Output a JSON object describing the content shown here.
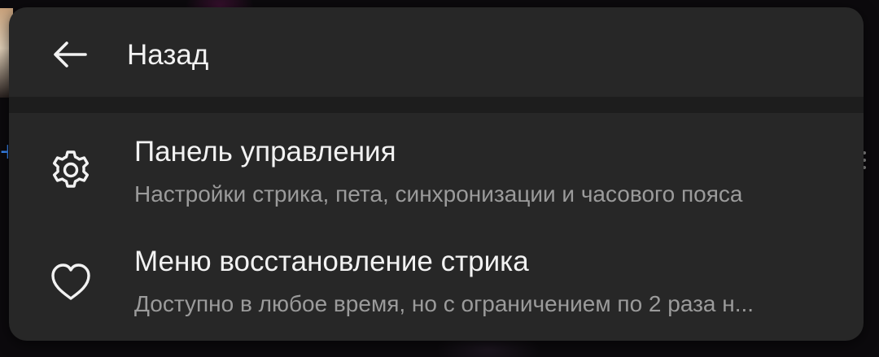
{
  "menu": {
    "header": {
      "back_icon": "arrow-left-icon",
      "title": "Назад"
    },
    "items": [
      {
        "icon": "gear-icon",
        "title": "Панель управления",
        "subtitle": "Настройки стрика, пета, синхронизации и часового пояса"
      },
      {
        "icon": "heart-icon",
        "title": "Меню восстановление стрика",
        "subtitle": "Доступно в любое время, но с ограничением по 2 раза н..."
      }
    ]
  },
  "colors": {
    "menu_background": "#272727",
    "separator": "#1d1d1d",
    "primary_text": "#f2f2f2",
    "secondary_text": "#9b9b9b",
    "page_background": "#0c0a0d",
    "accent": "#3b8dff"
  }
}
